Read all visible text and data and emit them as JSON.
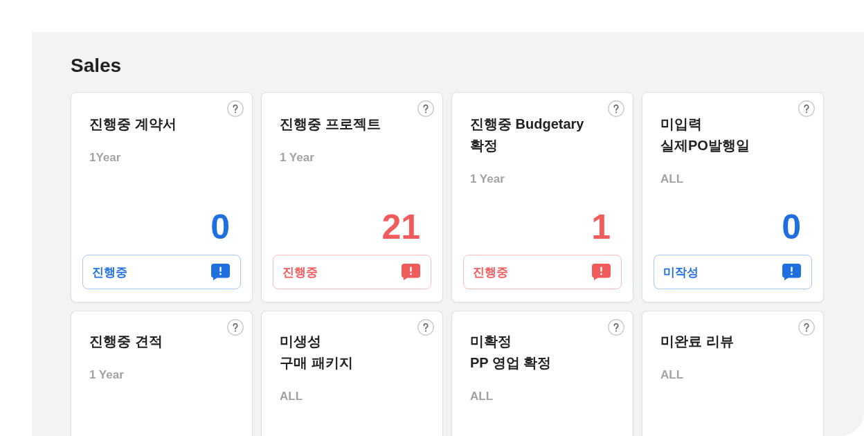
{
  "section": {
    "title": "Sales",
    "cards": [
      {
        "title": "진행중 계약서",
        "period": "1Year",
        "value": "0",
        "color": "#1f6fde",
        "badge": "진행중"
      },
      {
        "title": "진행중 프로젝트",
        "period": "1 Year",
        "value": "21",
        "color": "#f05b5b",
        "badge": "진행중"
      },
      {
        "title": "진행중 Budgetary\n확정",
        "period": "1 Year",
        "value": "1",
        "color": "#f05b5b",
        "badge": "진행중"
      },
      {
        "title": "미입력\n실제PO발행일",
        "period": "ALL",
        "value": "0",
        "color": "#1f6fde",
        "badge": "미작성"
      },
      {
        "title": "진행중 견적",
        "period": "1 Year"
      },
      {
        "title": "미생성\n구매 패키지",
        "period": "ALL"
      },
      {
        "title": "미확정\nPP 영업 확정",
        "period": "ALL"
      },
      {
        "title": "미완료 리뷰",
        "period": "ALL"
      }
    ]
  }
}
